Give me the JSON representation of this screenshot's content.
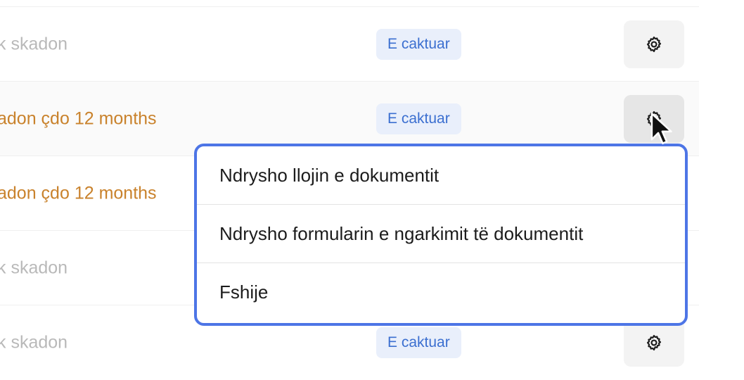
{
  "rows": [
    {
      "status": "k skadon",
      "status_tone": "muted",
      "badge": "E caktuar"
    },
    {
      "status": "adon çdo 12 months",
      "status_tone": "warn",
      "badge": "E caktuar"
    },
    {
      "status": "adon çdo 12 months",
      "status_tone": "warn",
      "badge": ""
    },
    {
      "status": "k skadon",
      "status_tone": "muted",
      "badge": ""
    },
    {
      "status": "k skadon",
      "status_tone": "muted",
      "badge": "E caktuar"
    }
  ],
  "menu": {
    "items": [
      {
        "label": "Ndrysho llojin e dokumentit"
      },
      {
        "label": "Ndrysho formularin e ngarkimit të dokumentit"
      },
      {
        "label": "Fshije"
      }
    ]
  },
  "colors": {
    "badge_bg": "#e9effb",
    "badge_text": "#3b6fd0",
    "warn_text": "#c9822c",
    "muted_text": "#b9b9b9",
    "menu_border": "#4d75e6"
  },
  "icons": {
    "row_action": "gear-icon",
    "pointer": "cursor-arrow-icon"
  }
}
